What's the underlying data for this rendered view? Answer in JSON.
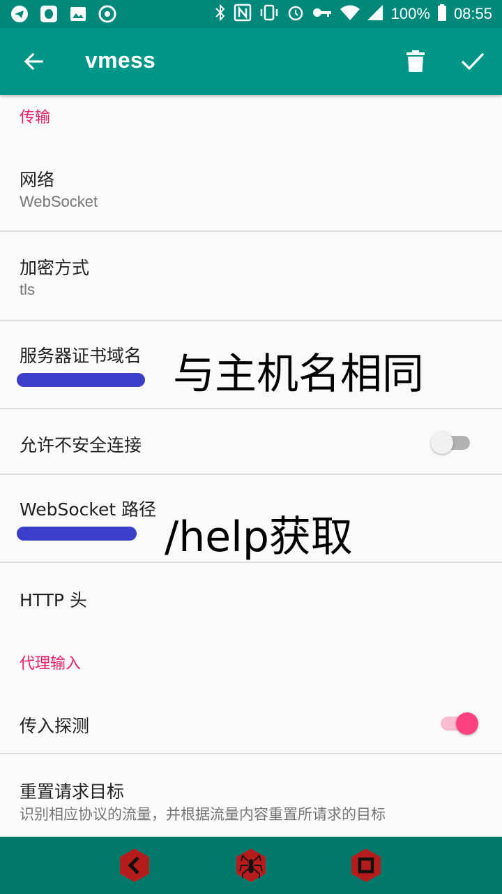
{
  "statusbar": {
    "left_icons": [
      "telegram-icon",
      "qq-icon",
      "image-icon",
      "aperture-icon"
    ],
    "right_icons": [
      "bluetooth-icon",
      "nfc-icon",
      "vibrate-icon",
      "alarm-icon",
      "key-icon",
      "wifi-icon",
      "signal-icon"
    ],
    "battery": "100%",
    "time": "08:55"
  },
  "appbar": {
    "title": "vmess",
    "back_icon": "arrow-back-icon",
    "delete_icon": "trash-icon",
    "save_icon": "check-icon"
  },
  "sections": {
    "transport_header": "传输",
    "proxy_input_header": "代理输入"
  },
  "settings": {
    "network": {
      "label": "网络",
      "value": "WebSocket"
    },
    "security": {
      "label": "加密方式",
      "value": "tls"
    },
    "sni": {
      "label": "服务器证书域名",
      "value": ""
    },
    "allow_insecure": {
      "label": "允许不安全连接",
      "enabled": false
    },
    "ws_path": {
      "label": "WebSocket 路径",
      "value": ""
    },
    "http_headers": {
      "label": "HTTP 头"
    },
    "sniffing": {
      "label": "传入探测",
      "enabled": true
    },
    "reset_target": {
      "label": "重置请求目标",
      "summary": "识别相应协议的流量，并根据流量内容重置所请求的目标"
    }
  },
  "annotations": {
    "sni_note": "与主机名相同",
    "path_note": "/help获取"
  },
  "colors": {
    "statusbar": "#00897b",
    "appbar": "#009688",
    "accent": "#ff4081",
    "section_header": "#e91e63",
    "navbar": "#00796b",
    "scribble": "#3b3fc9",
    "nav_button": "#b71c1c"
  },
  "navbar": {
    "buttons": [
      "back-hex-icon",
      "spider-hex-icon",
      "stop-hex-icon"
    ]
  }
}
